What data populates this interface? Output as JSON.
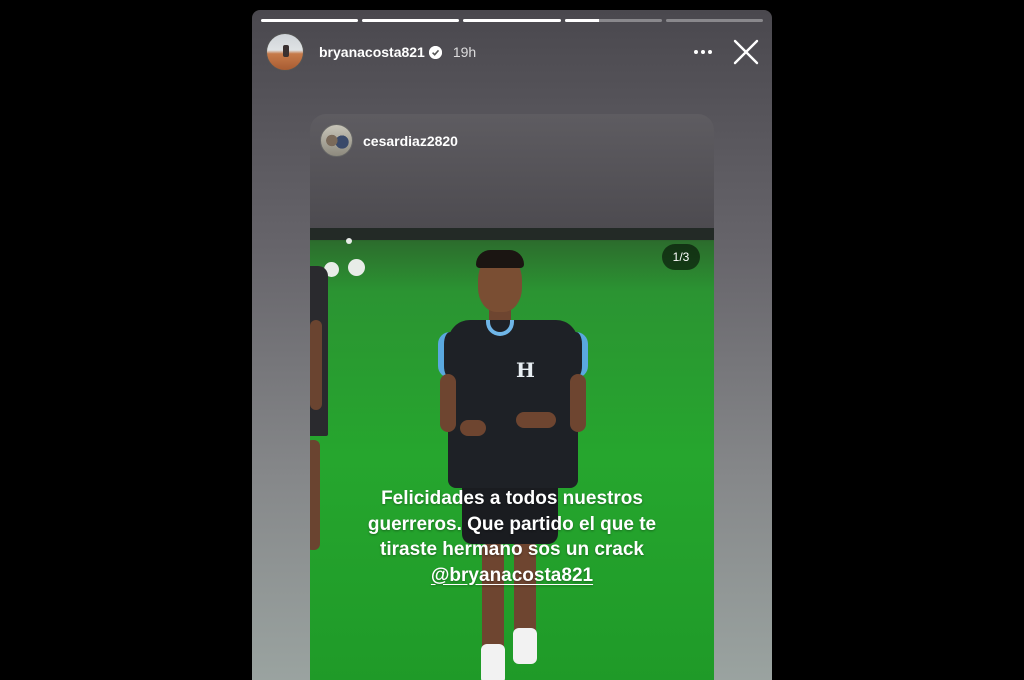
{
  "story": {
    "progress_fractions": [
      1,
      1,
      1,
      0.35,
      0
    ],
    "user": {
      "username": "bryanacosta821",
      "verified": true,
      "time_ago": "19h"
    },
    "icons": {
      "more": "more-horizontal-icon",
      "close": "close-icon",
      "verified": "verified-badge-icon"
    }
  },
  "shared_post": {
    "username": "cesardiaz2820",
    "page_indicator": "1/3",
    "caption_lines": [
      "Felicidades a todos nuestros",
      "guerreros. Que partido el que te",
      "tiraste hermano sos un crack"
    ],
    "mention": "@bryanacosta821"
  }
}
